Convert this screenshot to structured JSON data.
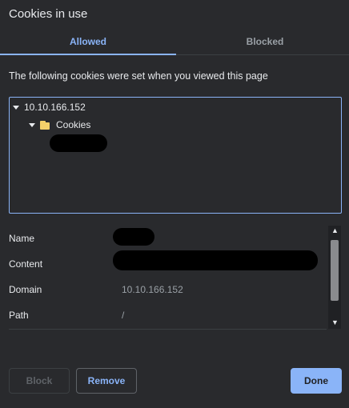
{
  "dialog": {
    "title": "Cookies in use"
  },
  "tabs": [
    {
      "label": "Allowed",
      "active": true
    },
    {
      "label": "Blocked",
      "active": false
    }
  ],
  "intro_text": "The following cookies were set when you viewed this page",
  "tree": {
    "site": "10.10.166.152",
    "folder": "Cookies",
    "folder_icon": "folder-icon"
  },
  "details": {
    "name_label": "Name",
    "content_label": "Content",
    "domain_label": "Domain",
    "domain_value": "10.10.166.152",
    "path_label": "Path",
    "path_value": "/"
  },
  "buttons": {
    "block": "Block",
    "remove": "Remove",
    "done": "Done"
  },
  "colors": {
    "accent": "#8ab4f8",
    "background": "#292a2d"
  }
}
